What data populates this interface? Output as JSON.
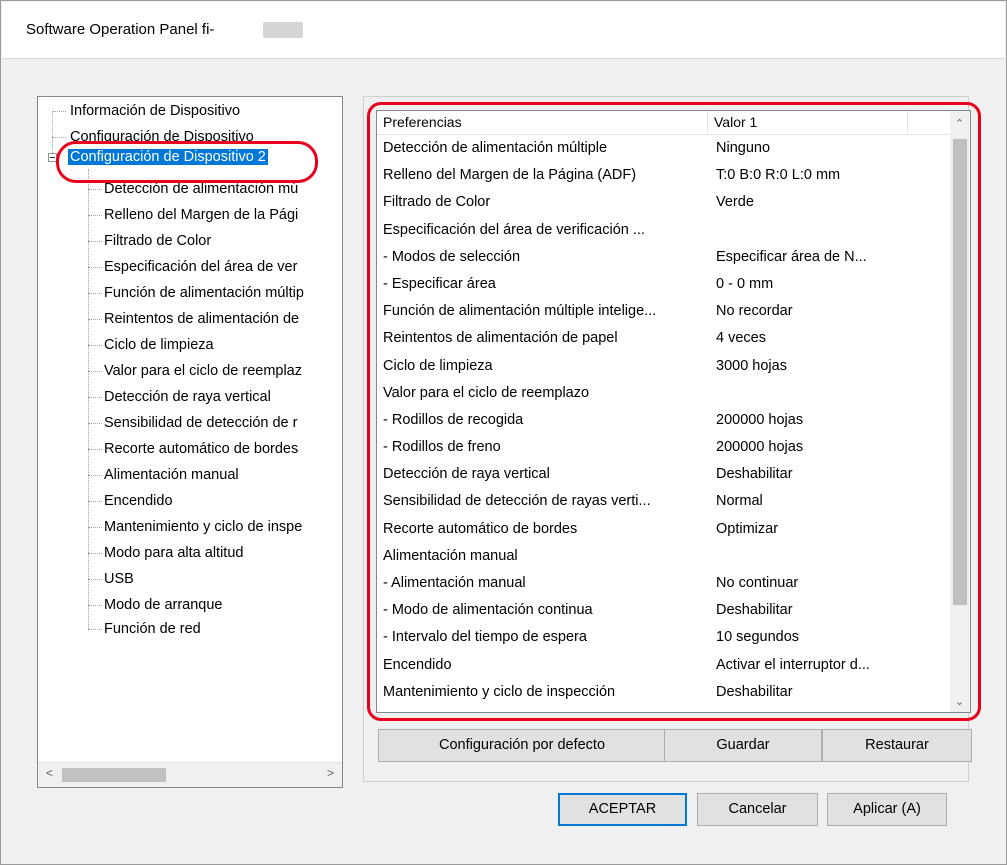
{
  "window": {
    "title": "Software Operation Panel fi-"
  },
  "tree": {
    "top_items": [
      "Información de Dispositivo",
      "Configuración de Dispositivo",
      "Configuración de Dispositivo 2"
    ],
    "children": [
      "Detección de alimentación mú",
      "Relleno del Margen de la Pági",
      "Filtrado de Color",
      "Especificación del área de ver",
      "Función de alimentación múltip",
      "Reintentos de alimentación de",
      "Ciclo de limpieza",
      "Valor para el ciclo de reemplaz",
      "Detección de raya vertical",
      "Sensibilidad de detección de r",
      "Recorte automático de bordes",
      "Alimentación manual",
      "Encendido",
      "Mantenimiento y ciclo de inspe",
      "Modo para alta altitud",
      "USB",
      "Modo de arranque",
      "Función de red"
    ],
    "scroll_left": "<",
    "scroll_right": ">"
  },
  "list": {
    "headers": [
      "Preferencias",
      "Valor 1"
    ],
    "rows": [
      [
        "Detección de alimentación múltiple",
        "Ninguno"
      ],
      [
        "Relleno del Margen de la Página (ADF)",
        "T:0  B:0  R:0  L:0 mm"
      ],
      [
        "Filtrado de Color",
        "Verde"
      ],
      [
        "Especificación del área de verificación ...",
        ""
      ],
      [
        " - Modos de selección",
        "Especificar área de N..."
      ],
      [
        " - Especificar área",
        "0 - 0 mm"
      ],
      [
        "Función de alimentación múltiple intelige...",
        " No recordar"
      ],
      [
        "Reintentos de alimentación de papel",
        "4 veces"
      ],
      [
        "Ciclo de limpieza",
        "3000 hojas"
      ],
      [
        "Valor para el ciclo de reemplazo",
        ""
      ],
      [
        " - Rodillos de recogida",
        "200000 hojas"
      ],
      [
        " - Rodillos de freno",
        "200000 hojas"
      ],
      [
        "Detección de raya vertical",
        "Deshabilitar"
      ],
      [
        "Sensibilidad de detección de rayas verti...",
        "Normal"
      ],
      [
        "Recorte automático de bordes",
        "Optimizar"
      ],
      [
        "Alimentación manual",
        ""
      ],
      [
        " - Alimentación manual",
        "No continuar"
      ],
      [
        " - Modo de alimentación continua",
        "Deshabilitar"
      ],
      [
        " - Intervalo del tiempo de espera",
        "10 segundos"
      ],
      [
        "Encendido",
        "Activar el interruptor d..."
      ],
      [
        "Mantenimiento y ciclo de inspección",
        "Deshabilitar"
      ]
    ]
  },
  "group_buttons": {
    "defaults": "Configuración por defecto",
    "save": "Guardar",
    "restore": "Restaurar"
  },
  "dialog_buttons": {
    "ok": "ACEPTAR",
    "cancel": "Cancelar",
    "apply": "Aplicar (A)"
  },
  "colors": {
    "highlight": "#e8001c",
    "selection": "#0078d7"
  }
}
